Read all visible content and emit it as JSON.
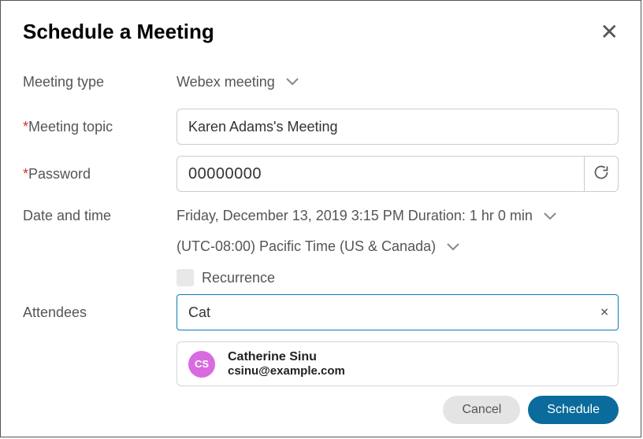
{
  "header": {
    "title": "Schedule a Meeting"
  },
  "labels": {
    "meeting_type": "Meeting type",
    "meeting_topic": "Meeting topic",
    "password": "Password",
    "date_time": "Date and time",
    "attendees": "Attendees"
  },
  "meeting_type": {
    "selected": "Webex meeting"
  },
  "topic": {
    "value": "Karen Adams's Meeting"
  },
  "password": {
    "value": "00000000"
  },
  "datetime": {
    "summary": "Friday, December 13, 2019 3:15 PM Duration: 1 hr 0 min",
    "timezone": "(UTC-08:00) Pacific Time (US & Canada)",
    "recurrence_label": "Recurrence"
  },
  "attendees": {
    "value": "Cat",
    "suggestion": {
      "initials": "CS",
      "name": "Catherine Sinu",
      "email": "csinu@example.com"
    }
  },
  "footer": {
    "cancel": "Cancel",
    "schedule": "Schedule"
  }
}
